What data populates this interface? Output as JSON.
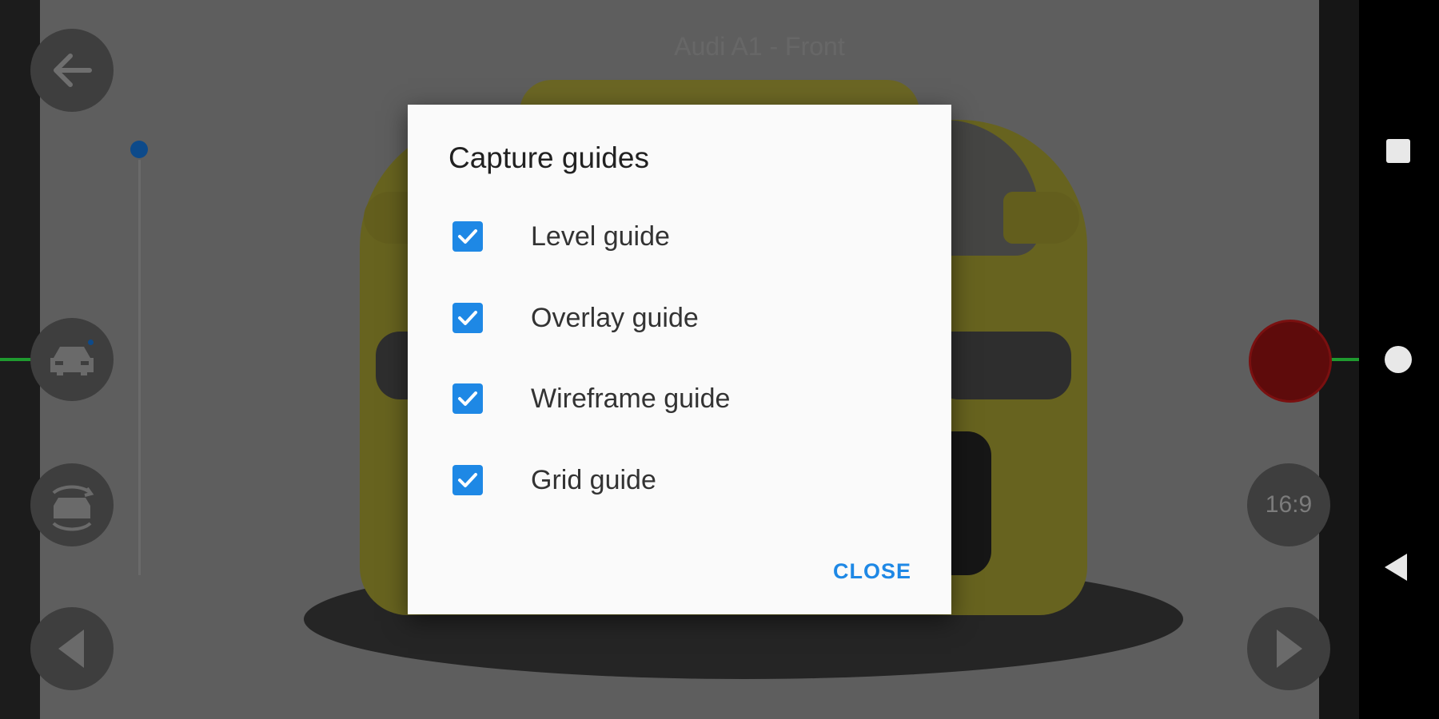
{
  "scene": {
    "title": "Audi A1 - Front"
  },
  "controls": {
    "back_icon": "arrow-left-icon",
    "car_icon": "car-front-icon",
    "rotate_icon": "rotate-car-icon",
    "prev_icon": "triangle-left-icon",
    "next_icon": "triangle-right-icon",
    "aspect_ratio": "16:9",
    "shutter_color": "#5e0b0b",
    "slider_level": 0.0
  },
  "dialog": {
    "title": "Capture guides",
    "options": [
      {
        "label": "Level guide",
        "checked": true
      },
      {
        "label": "Overlay guide",
        "checked": true
      },
      {
        "label": "Wireframe guide",
        "checked": true
      },
      {
        "label": "Grid guide",
        "checked": true
      }
    ],
    "close_label": "CLOSE",
    "accent_color": "#1e88e5"
  },
  "system_nav": {
    "icons": [
      "recents-square-icon",
      "home-circle-icon",
      "back-triangle-icon"
    ]
  }
}
